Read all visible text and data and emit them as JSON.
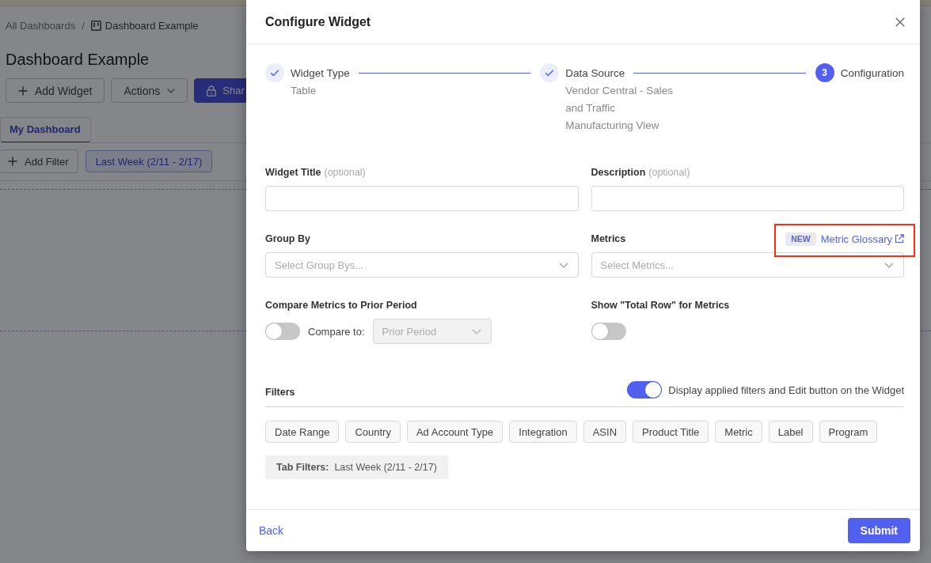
{
  "page": {
    "breadcrumb": [
      {
        "label": "All Dashboards",
        "current": false
      },
      {
        "label": "Dashboard Example",
        "current": true
      }
    ],
    "separator": "/",
    "title": "Dashboard Example",
    "buttons": [
      {
        "kind": "add",
        "label": "Add Widget"
      },
      {
        "kind": "menu",
        "label": "Actions"
      },
      {
        "kind": "share",
        "label": "Shar"
      }
    ],
    "tabs": [
      {
        "label": "My Dashboard",
        "selected": true
      }
    ],
    "add_filter": "Add Filter",
    "filter_chips": [
      "Last Week (2/11 - 2/17)"
    ]
  },
  "modal": {
    "title": "Configure Widget",
    "steps": [
      {
        "title": "Widget Type",
        "done": true,
        "details": [
          "Table"
        ]
      },
      {
        "title": "Data Source",
        "done": true,
        "details": [
          "Vendor Central - Sales and Traffic",
          "Manufacturing View"
        ]
      },
      {
        "title": "Configuration",
        "done": false,
        "number": "3"
      }
    ],
    "fields": [
      {
        "kind": "text",
        "label": "Widget Title",
        "hint": "(optional)"
      },
      {
        "kind": "text",
        "label": "Description",
        "hint": "(optional)"
      },
      {
        "kind": "select",
        "label": "Group By",
        "placeholder": "Select Group Bys..."
      },
      {
        "kind": "select",
        "label": "Metrics",
        "placeholder": "Select Metrics...",
        "link": {
          "badge": "NEW",
          "label": "Metric Glossary",
          "highlighted": true
        }
      },
      {
        "kind": "toggle",
        "label": "Compare Metrics to Prior Period",
        "on": false,
        "compare": {
          "label": "Compare to:",
          "value": "Prior Period",
          "disabled": true
        }
      },
      {
        "kind": "toggle",
        "label": "Show \"Total Row\" for Metrics",
        "on": false
      }
    ],
    "filters": {
      "title": "Filters",
      "display_toggle": {
        "on": true,
        "label": "Display applied filters and Edit button on the Widget"
      },
      "options": [
        "Date Range",
        "Country",
        "Ad Account Type",
        "Integration",
        "ASIN",
        "Product Title",
        "Metric",
        "Label",
        "Program"
      ],
      "tab_filters": "**Tab Filters:**  Last Week (2/11 - 2/17)"
    },
    "footer": {
      "back": "Back",
      "submit": "Submit"
    }
  }
}
